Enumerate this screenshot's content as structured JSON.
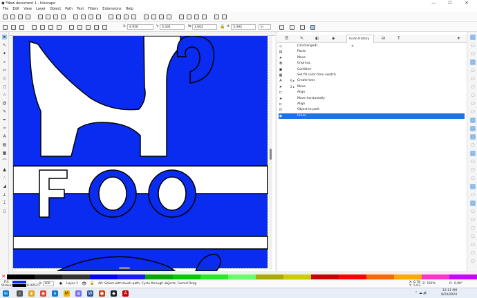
{
  "window": {
    "title": "*New document 1 - Inkscape",
    "minimize": "—",
    "maximize": "☐",
    "close": "✕"
  },
  "menu": [
    "File",
    "Edit",
    "View",
    "Layer",
    "Object",
    "Path",
    "Text",
    "Filters",
    "Extensions",
    "Help"
  ],
  "controls": {
    "x_label": "X:",
    "x_value": "4.956",
    "y_label": "Y:",
    "y_value": "3.331",
    "w_label": "W:",
    "w_value": "3.002",
    "h_label": "H:",
    "h_value": "3.393",
    "unit": "in"
  },
  "canvas": {
    "text": "FOO",
    "colors": {
      "blue": "#0a2cf0",
      "black": "#000000",
      "white": "#ffffff"
    }
  },
  "panel": {
    "tab_label": "Undo History",
    "close": "✕",
    "history": [
      {
        "icon": "unchanged-icon",
        "glyph": "◇",
        "count": "",
        "label": "[Unchanged]"
      },
      {
        "icon": "paste-icon",
        "glyph": "▤",
        "count": "",
        "label": "Paste"
      },
      {
        "icon": "move-icon",
        "glyph": "➤",
        "count": "",
        "label": "Move"
      },
      {
        "icon": "ungroup-icon",
        "glyph": "⧉",
        "count": "",
        "label": "Ungroup"
      },
      {
        "icon": "combine-icon",
        "glyph": "▣",
        "count": "",
        "label": "Combine"
      },
      {
        "icon": "fill-swatch-icon",
        "glyph": "▦",
        "count": "",
        "label": "Set fill color from swatch"
      },
      {
        "icon": "text-icon",
        "glyph": "A",
        "count": "6  ▸",
        "label": "Create text"
      },
      {
        "icon": "move-icon",
        "glyph": "➤",
        "count": "2  ▸",
        "label": "Move"
      },
      {
        "icon": "align-icon",
        "glyph": "⊏",
        "count": "",
        "label": "Align"
      },
      {
        "icon": "move-horizontal-icon",
        "glyph": "➤",
        "count": "",
        "label": "Move horizontally"
      },
      {
        "icon": "align-icon",
        "glyph": "⊏",
        "count": "",
        "label": "Align"
      },
      {
        "icon": "object-to-path-icon",
        "glyph": "◰",
        "count": "",
        "label": "Object to path"
      },
      {
        "icon": "union-icon",
        "glyph": "◉",
        "count": "",
        "label": "Union"
      }
    ]
  },
  "status": {
    "fill_label": "Fill:",
    "stroke_label": "Stroke:",
    "stroke_width": "0.00521",
    "opacity_label": "O:",
    "opacity_value": "100",
    "layer": "Layer 1",
    "message": "Alt: Select with touch-path, Cycle through objects, Forced Drag",
    "x_label": "X:",
    "x_value": "6.78",
    "y_label": "Y:",
    "y_value": "5.03",
    "zoom_label": "Z:",
    "zoom_value": "782%",
    "rot_label": "R:",
    "rot_value": "0.00°"
  },
  "taskbar": {
    "time": "12:11 PM",
    "date": "8/24/2024"
  },
  "palette_colors": [
    "#000000",
    "#1a1a1a",
    "#333333",
    "#0000ff",
    "#1a1aff",
    "#00aa00",
    "#00cc00",
    "#22ee22",
    "#66ff66",
    "#aaaa00",
    "#cccc00",
    "#cc0000",
    "#ff0000",
    "#ff6600",
    "#ffaa00",
    "#ff33cc",
    "#cc00ff"
  ]
}
